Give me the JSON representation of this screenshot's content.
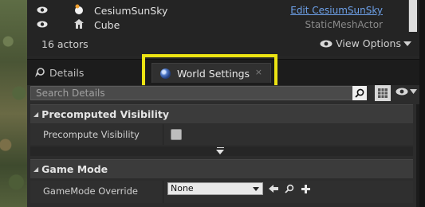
{
  "outliner": {
    "rows": [
      {
        "name": "CesiumSunSky",
        "type": "Edit CesiumSunSky",
        "type_is_link": true
      },
      {
        "name": "Cube",
        "type": "StaticMeshActor",
        "type_is_link": false
      }
    ],
    "actor_count": "16 actors",
    "view_options": "View Options"
  },
  "tabs": {
    "details": "Details",
    "world_settings": "World Settings",
    "close": "×"
  },
  "search": {
    "placeholder": "Search Details"
  },
  "sections": {
    "precomputed_visibility": {
      "title": "Precomputed Visibility",
      "prop_label": "Precompute Visibility",
      "checked": false
    },
    "game_mode": {
      "title": "Game Mode",
      "prop_label": "GameMode Override",
      "selected": "None"
    }
  },
  "colors": {
    "highlight": "#ece313",
    "link": "#6da0e8"
  }
}
